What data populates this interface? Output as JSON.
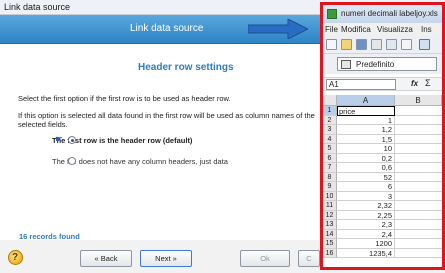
{
  "dialog": {
    "window_title": "Link data source",
    "banner_title": "Link data source",
    "section_title": "Header row settings",
    "instruction_1": "Select the first option if the first row is to be used as header row.",
    "instruction_2": "If this option is selected all data found in the first row will be used as column names of the selected fields.",
    "option_header": "The first row is the header row (default)",
    "option_no_header": "The file does not have any column headers, just data",
    "selected_option": "option_header",
    "records_found": "16 records found",
    "buttons": {
      "back": "« Back",
      "next": "Next »",
      "ok": "Ok",
      "cancel": "C"
    }
  },
  "spreadsheet": {
    "title": "numeri decimali labeljoy.xls",
    "menu": [
      "File",
      "Modifica",
      "Visualizza",
      "Ins"
    ],
    "style_name": "Predefinito",
    "cell_ref": "A1",
    "fx": "fx",
    "sigma": "Σ",
    "columns": [
      "A",
      "B"
    ],
    "rows": [
      {
        "n": "1",
        "a": "price"
      },
      {
        "n": "2",
        "a": "1"
      },
      {
        "n": "3",
        "a": "1,2"
      },
      {
        "n": "4",
        "a": "1,5"
      },
      {
        "n": "5",
        "a": "10"
      },
      {
        "n": "6",
        "a": "0,2"
      },
      {
        "n": "7",
        "a": "0,6"
      },
      {
        "n": "8",
        "a": "52"
      },
      {
        "n": "9",
        "a": "6"
      },
      {
        "n": "10",
        "a": "3"
      },
      {
        "n": "11",
        "a": "2,32"
      },
      {
        "n": "12",
        "a": "2,25"
      },
      {
        "n": "13",
        "a": "2,3"
      },
      {
        "n": "14",
        "a": "2,4"
      },
      {
        "n": "15",
        "a": "1200"
      },
      {
        "n": "16",
        "a": "1235,4"
      }
    ],
    "highlight_color": "#e0141c"
  }
}
